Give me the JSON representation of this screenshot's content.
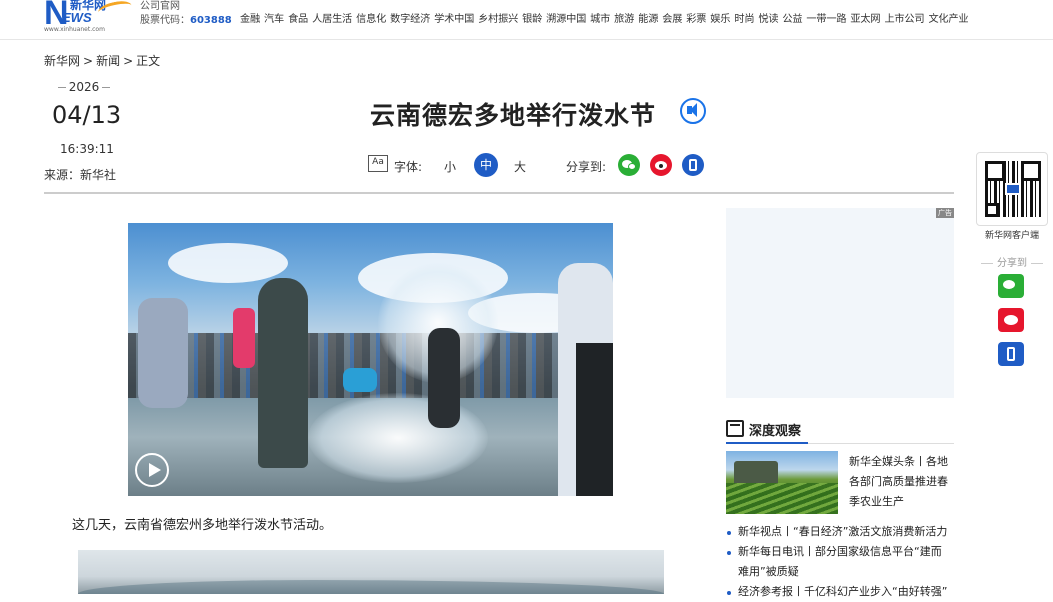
{
  "header": {
    "logo_text": "NEWS",
    "logo_cn": "新华网",
    "logo_url": "www.xinhuanet.com",
    "company_site": "公司官网",
    "stock_label": "股票代码：",
    "stock_code": "603888",
    "channels": [
      "金融",
      "汽车",
      "食品",
      "人居生活",
      "信息化",
      "数字经济",
      "学术中国",
      "乡村振兴",
      "银龄",
      "溯源中国",
      "城市",
      "旅游",
      "能源",
      "会展",
      "彩票",
      "娱乐",
      "时尚",
      "悦读",
      "公益",
      "一带一路",
      "亚太网",
      "上市公司",
      "文化产业"
    ]
  },
  "breadcrumb": [
    "新华网",
    ">",
    "新闻",
    ">",
    "正文"
  ],
  "meta": {
    "year": "2026",
    "month_day": "04/13",
    "time": "16:39:11",
    "source": "来源：新华社"
  },
  "article": {
    "title": "云南德宏多地举行泼水节",
    "paragraph1": "这几天，云南省德宏州多地举行泼水节活动。"
  },
  "toolbar": {
    "aa_icon": "Aa",
    "font_label": "字体:",
    "font_small": "小",
    "font_mid": "中",
    "font_big": "大",
    "share_label": "分享到:"
  },
  "right_rail": {
    "qr_label": "新华网客户端",
    "share_header": "分享到"
  },
  "ad": {
    "tag": "广告"
  },
  "deep": {
    "title": "深度观察",
    "feature_text": "新华全媒头条丨各地各部门高质量推进春季农业生产",
    "items": [
      "新华视点丨“春日经济”激活文旅消费新活力",
      "新华每日电讯丨部分国家级信息平台“建而",
      "难用”被质疑",
      "经济参考报丨千亿科幻产业步入“由好转强”"
    ]
  },
  "colors": {
    "brand": "#1f5cc5",
    "wechat": "#2aae36",
    "weibo": "#e6162d"
  }
}
